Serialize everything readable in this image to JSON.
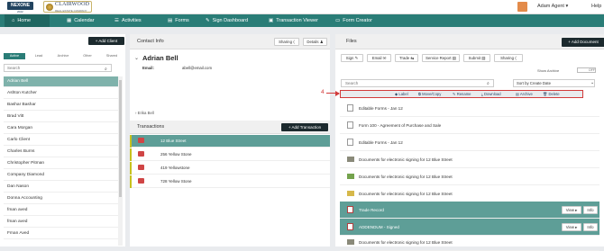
{
  "header": {
    "logo_text": "NEXONE",
    "logo_sub": "2022",
    "brand_name": "CLAIRWOOD",
    "brand_tag": "REAL ESTATE COMPANY",
    "agent": "Adam Agent ▾",
    "help": "Help"
  },
  "nav": [
    {
      "icon": "⌂",
      "label": "Home"
    },
    {
      "icon": "▦",
      "label": "Calendar"
    },
    {
      "icon": "☰",
      "label": "Activities"
    },
    {
      "icon": "▤",
      "label": "Forms"
    },
    {
      "icon": "✎",
      "label": "Sign Dashboard"
    },
    {
      "icon": "▣",
      "label": "Transaction Viewer"
    },
    {
      "icon": "▭",
      "label": "Form Creator"
    }
  ],
  "clients": {
    "add_label": "+ Add Client",
    "tabs": [
      "Active",
      "Lead",
      "Archive",
      "Other",
      "Shared"
    ],
    "search_placeholder": "Search",
    "list": [
      "Adrian Bell",
      "Ashton Kutcher",
      "Bashar Bashar",
      "Brad Vitt",
      "Cara Morgan",
      "Carlo Client",
      "Charles Burns",
      "Christopher Pitman",
      "Company Diamond",
      "Dan Nason",
      "Donna Accounting",
      "fman aved",
      "fman aved",
      "Fman Aved"
    ]
  },
  "contact": {
    "title": "Contact Info",
    "sharing": "Sharing ⟨",
    "details": "Details ♟",
    "name": "Adrian Bell",
    "email_label": "Email:",
    "email": "abell@email.com",
    "other": "Erika Bell"
  },
  "transactions": {
    "title": "Transactions",
    "add_label": "+ Add Transaction",
    "rows": [
      "12 Blue Street",
      "256 Yellow Stone",
      "419 Yellowstone",
      "728 Yellow Stone"
    ]
  },
  "files": {
    "title": "Files",
    "add_label": "+ Add Document",
    "tools": [
      "Sign ✎",
      "Email ✉",
      "Trade ⇆",
      "Service Report ▤",
      "Submit ▤",
      "Sharing ⟨"
    ],
    "show_archive": "Show Archive",
    "toggle": "OFF",
    "search_placeholder": "Search",
    "sort": "Sort by Create Date",
    "actions": [
      "Label",
      "Move/Copy",
      "Rename",
      "Download",
      "Archive",
      "Delete"
    ],
    "annotation": "4",
    "list": [
      {
        "name": "Editable Forms - Jan 12",
        "icon": "doc"
      },
      {
        "name": "Form 100 - Agreement of Purchase and Sale",
        "icon": "doc"
      },
      {
        "name": "Editable Forms - Jan 12",
        "icon": "doc"
      },
      {
        "name": "Documents for electronic signing for 12 Blue Street",
        "icon": "folder"
      },
      {
        "name": "Documents for electronic signing for 12 Blue Street",
        "icon": "folder-green"
      },
      {
        "name": "Documents for electronic signing for 12 Blue Street",
        "icon": "folder-yellow"
      },
      {
        "name": "Trade Record",
        "icon": "pdf"
      },
      {
        "name": "ADDENDUM - Signed",
        "icon": "pdf"
      },
      {
        "name": "Documents for electronic signing for 12 Blue Street",
        "icon": "folder"
      }
    ],
    "view_label": "View ▸",
    "info_label": "Info"
  }
}
